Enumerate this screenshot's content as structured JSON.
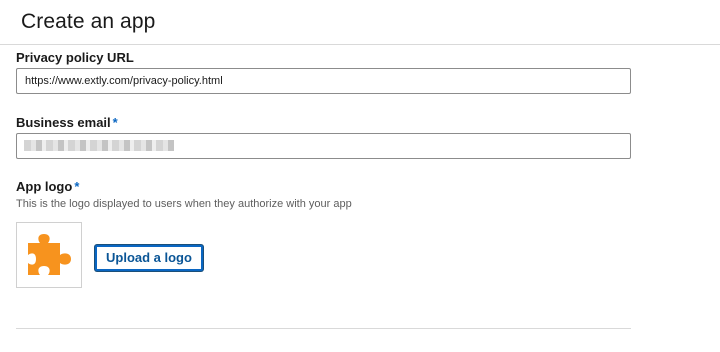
{
  "header": {
    "title": "Create an app"
  },
  "form": {
    "privacy_policy": {
      "label": "Privacy policy URL",
      "value": "https://www.extly.com/privacy-policy.html"
    },
    "business_email": {
      "label": "Business email",
      "required_mark": "*",
      "value": ""
    },
    "app_logo": {
      "label": "App logo",
      "required_mark": "*",
      "help_text": "This is the logo displayed to users when they authorize with your app",
      "upload_button_label": "Upload a logo",
      "logo_icon": "puzzle-piece-icon",
      "logo_color": "#f7931e"
    }
  },
  "colors": {
    "accent": "#0a66c2",
    "border": "#8c8c8c",
    "divider": "#d9d9d9"
  }
}
